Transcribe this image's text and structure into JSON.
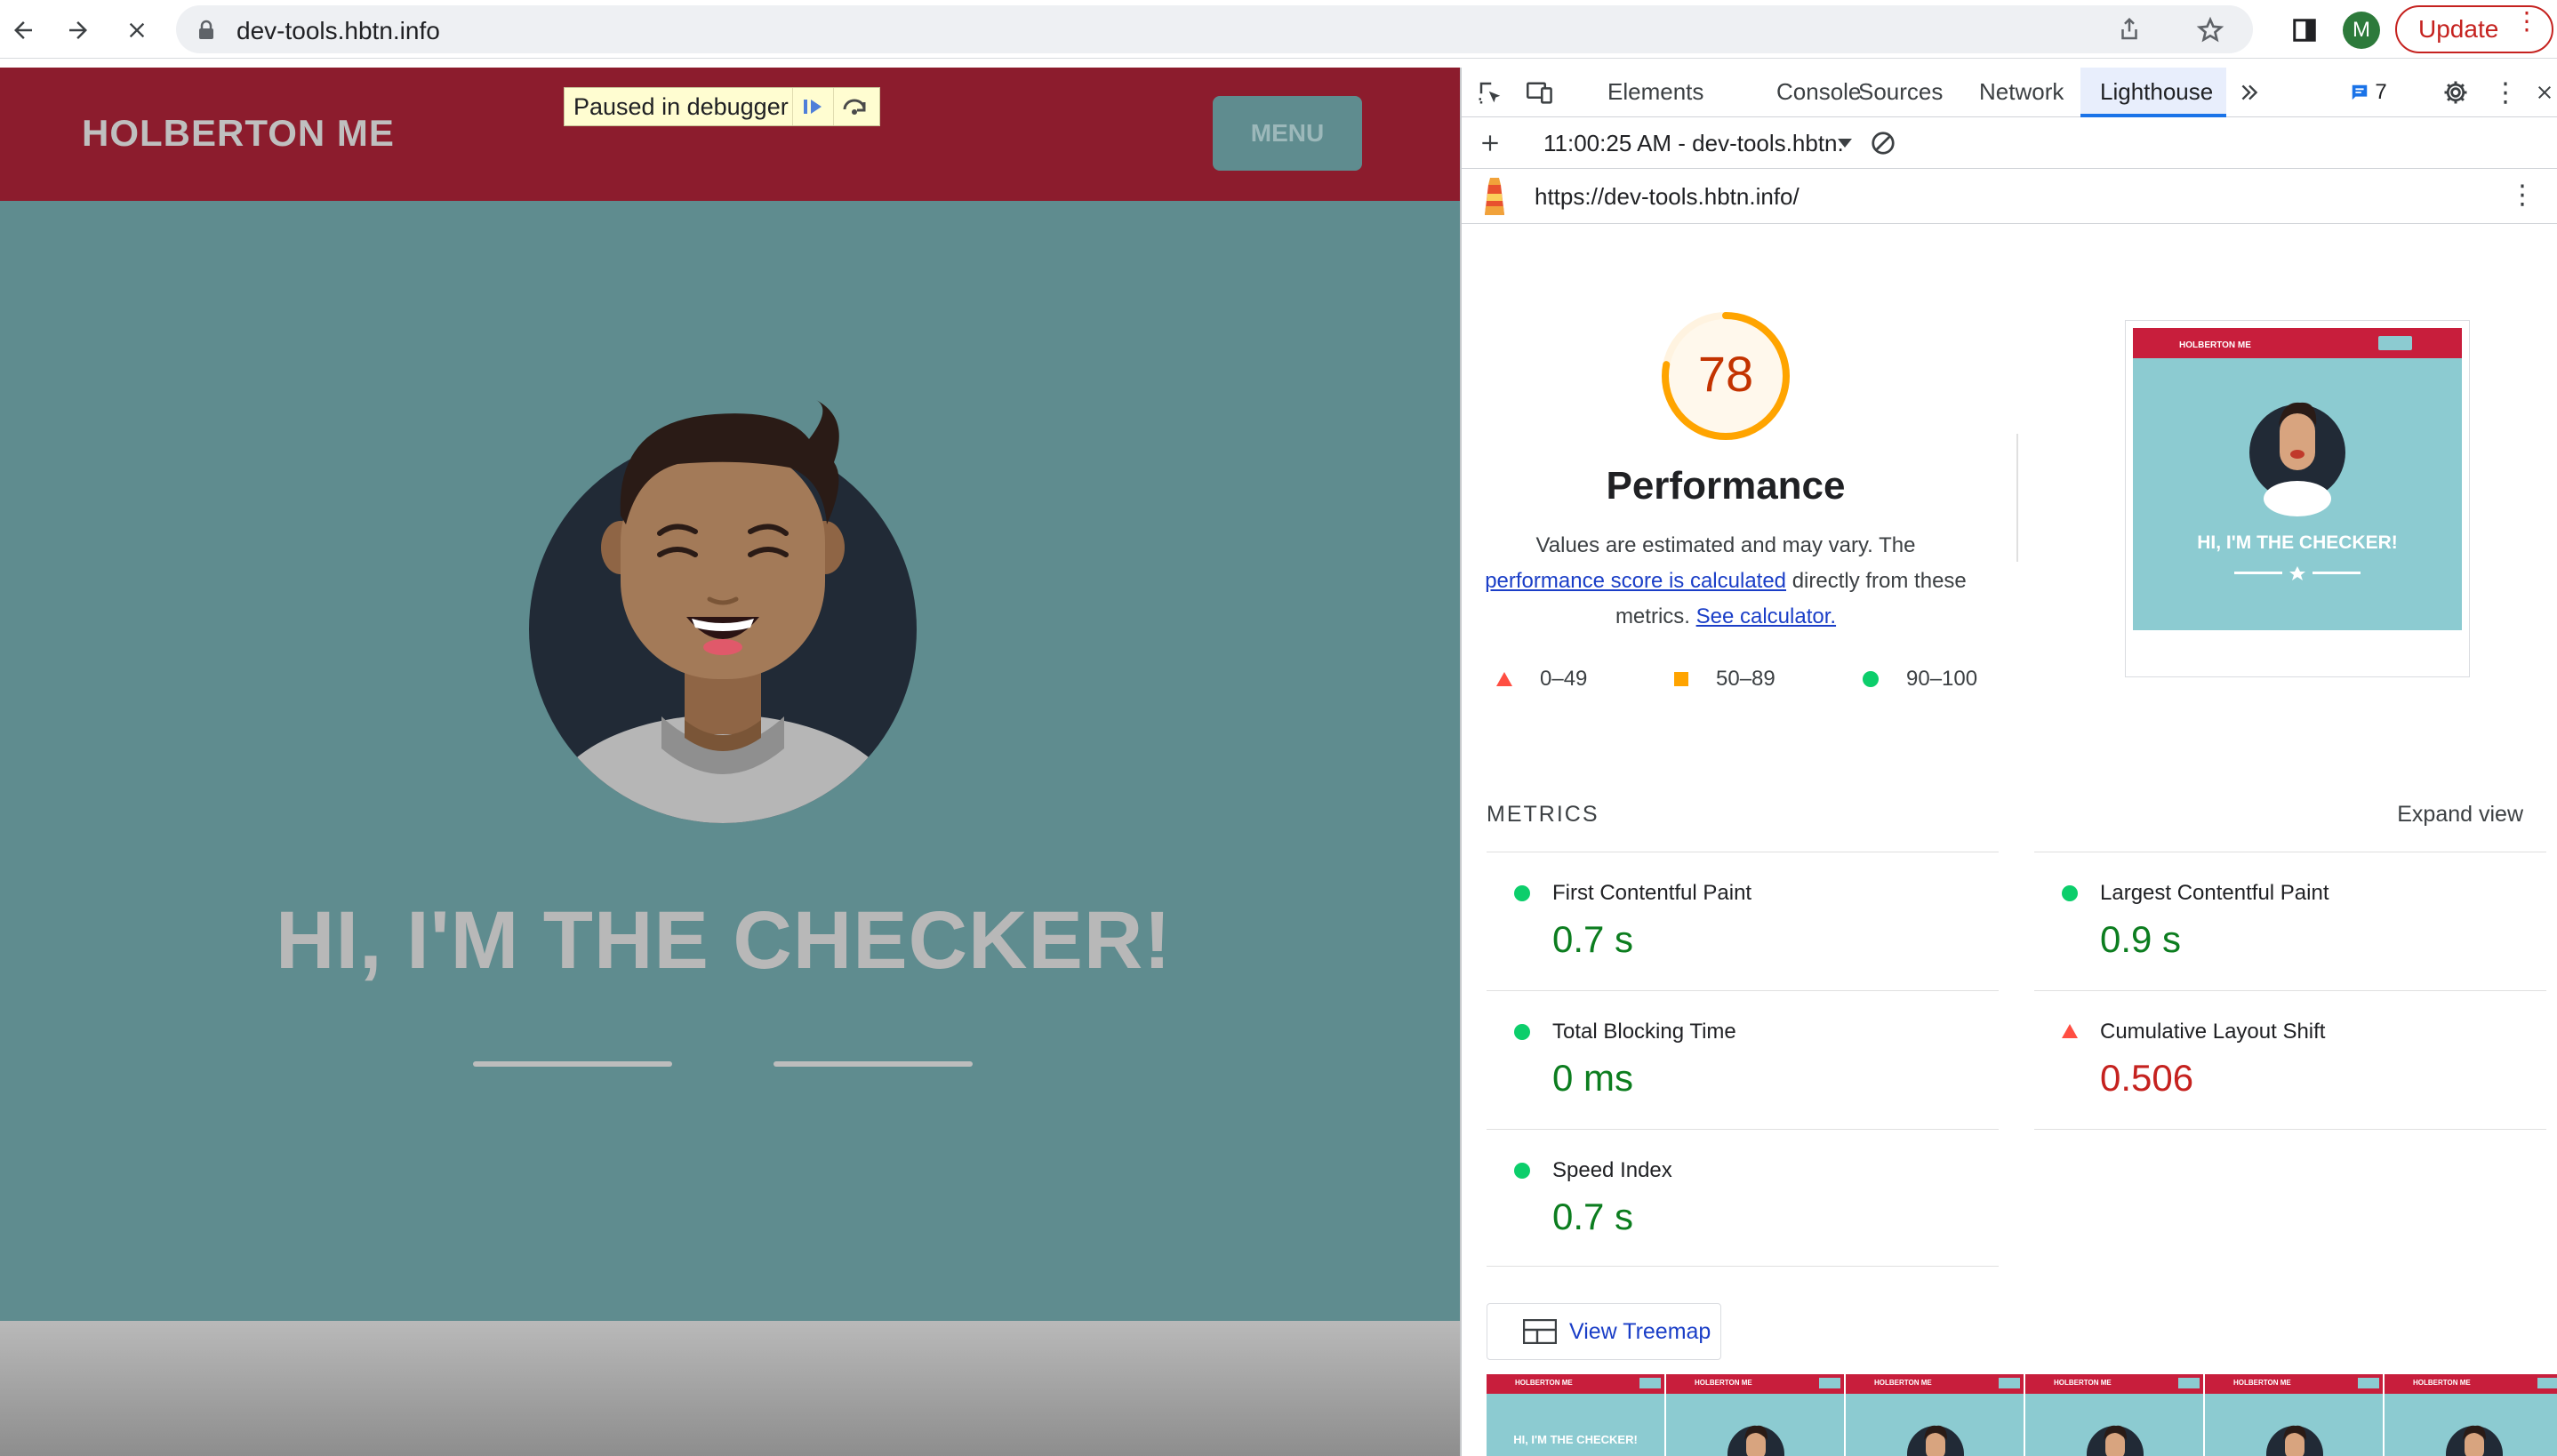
{
  "browser": {
    "url": "dev-tools.hbtn.info",
    "update_label": "Update",
    "profile_initial": "M"
  },
  "page": {
    "logo": "HOLBERTON ME",
    "menu_label": "MENU",
    "debugger_banner": "Paused in debugger",
    "hero_title": "HI, I'M THE CHECKER!"
  },
  "devtools": {
    "tabs": [
      "Elements",
      "Console",
      "Sources",
      "Network",
      "Lighthouse"
    ],
    "issues_count": "7",
    "run_label": "11:00:25 AM - dev-tools.hbtn.",
    "audited_url": "https://dev-tools.hbtn.info/",
    "score": "78",
    "score_value": 78,
    "category_title": "Performance",
    "desc_1": "Values are estimated and may vary. The",
    "desc_link_1": "performance score is calculated",
    "desc_2": "directly from these",
    "desc_3": "metrics.",
    "desc_link_2": "See calculator.",
    "legend": {
      "fail": "0–49",
      "average": "50–89",
      "pass": "90–100"
    },
    "metrics_heading": "METRICS",
    "expand_view": "Expand view",
    "metrics": [
      {
        "name": "First Contentful Paint",
        "value": "0.7 s",
        "status": "pass"
      },
      {
        "name": "Largest Contentful Paint",
        "value": "0.9 s",
        "status": "pass"
      },
      {
        "name": "Total Blocking Time",
        "value": "0 ms",
        "status": "pass"
      },
      {
        "name": "Cumulative Layout Shift",
        "value": "0.506",
        "status": "fail"
      },
      {
        "name": "Speed Index",
        "value": "0.7 s",
        "status": "pass"
      }
    ],
    "view_treemap": "View Treemap",
    "thumbnail": {
      "logo": "HOLBERTON ME",
      "title": "HI, I'M THE CHECKER!"
    },
    "filmstrip_frame_text": "HI, I'M THE CHECKER!"
  },
  "colors": {
    "header_red": "#8c1c2d",
    "page_teal": "#5f8c8f",
    "score_orange": "#ffa400",
    "pass_green": "#0cce6b",
    "fail_red": "#ff4e42",
    "link_blue": "#1a3ec7"
  }
}
